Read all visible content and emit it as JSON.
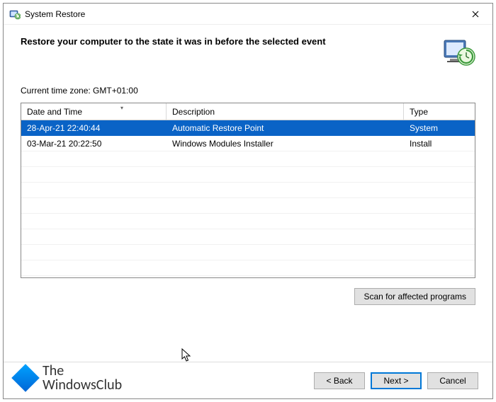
{
  "window": {
    "title": "System Restore"
  },
  "header": {
    "heading": "Restore your computer to the state it was in before the selected event"
  },
  "timezone_label": "Current time zone: GMT+01:00",
  "table": {
    "columns": {
      "date": "Date and Time",
      "desc": "Description",
      "type": "Type"
    },
    "rows": [
      {
        "date": "28-Apr-21 22:40:44",
        "desc": "Automatic Restore Point",
        "type": "System",
        "selected": true
      },
      {
        "date": "03-Mar-21 20:22:50",
        "desc": "Windows Modules Installer",
        "type": "Install",
        "selected": false
      }
    ]
  },
  "buttons": {
    "scan": "Scan for affected programs",
    "back": "< Back",
    "next": "Next >",
    "cancel": "Cancel"
  },
  "brand": {
    "line1": "The",
    "line2": "WindowsClub"
  }
}
